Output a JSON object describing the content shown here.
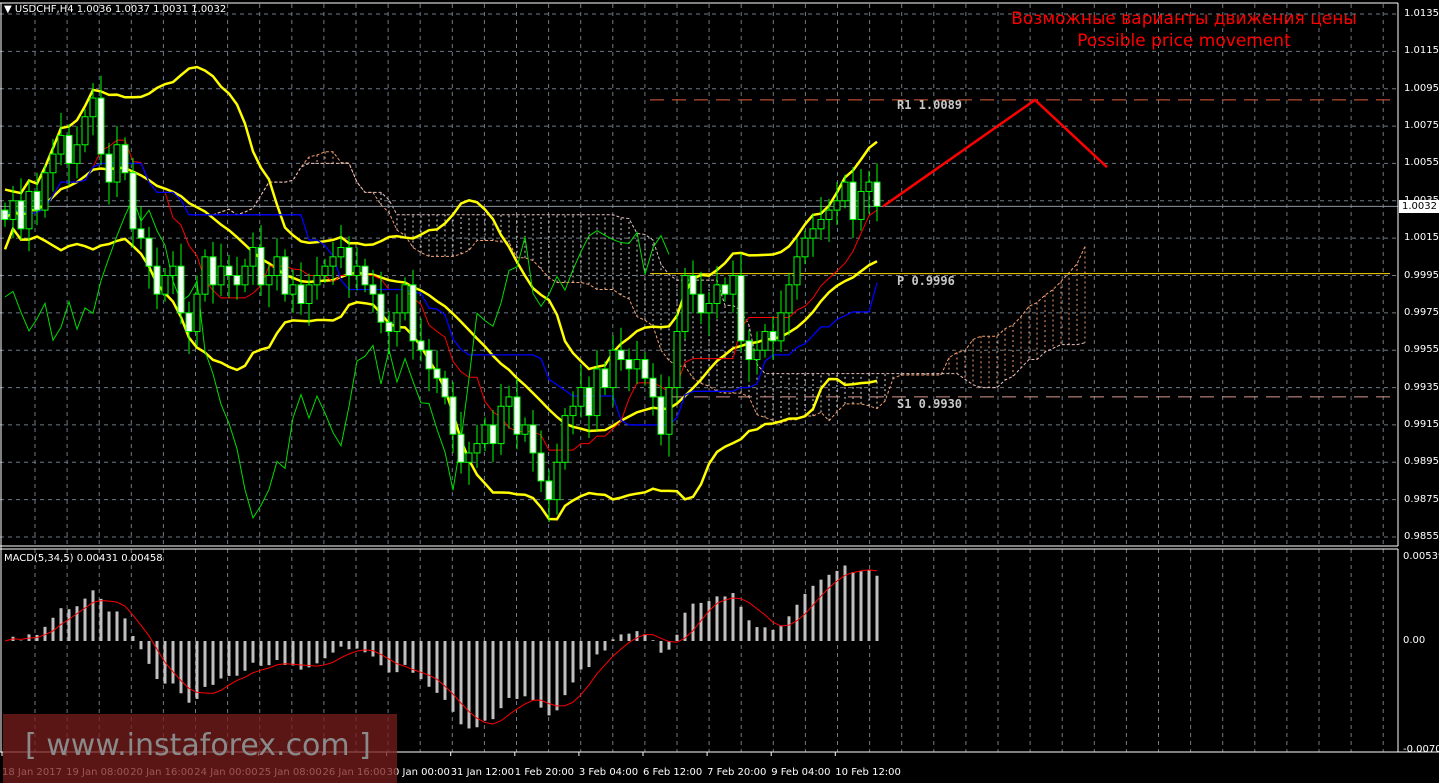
{
  "header": {
    "symbol_label": "USDCHF,H4",
    "ohlc": "1.0036 1.0037 1.0031 1.0032"
  },
  "annotation": {
    "line1": "Возможные варианты движения цены",
    "line2": "Possible price movement",
    "color": "#ff0000"
  },
  "levels": [
    {
      "label": "R1 1.0089",
      "price": 1.0089,
      "style": "dashed",
      "color": "#e0603a"
    },
    {
      "label": "P 0.9996",
      "price": 0.9996,
      "style": "solid",
      "color": "#ffd700"
    },
    {
      "label": "S1 0.9930",
      "price": 0.993,
      "style": "dashed",
      "color": "#d89a90"
    }
  ],
  "current_price": {
    "label": "1.0032",
    "price": 1.0032
  },
  "price_axis": [
    "1.0135",
    "1.0115",
    "1.0095",
    "1.0075",
    "1.0055",
    "1.0035",
    "1.0015",
    "0.9995",
    "0.9975",
    "0.9955",
    "0.9935",
    "0.9915",
    "0.9895",
    "0.9875",
    "0.9855"
  ],
  "macd": {
    "label": "MACD(5,34,5) 0.00431 0.00458",
    "axis": [
      "0.00539",
      "0.00",
      "-0.00709"
    ]
  },
  "time_axis": [
    "18 Jan 2017",
    "19 Jan 08:00",
    "20 Jan 16:00",
    "24 Jan 00:00",
    "25 Jan 08:00",
    "26 Jan 16:00",
    "30 Jan 00:00",
    "31 Jan 12:00",
    "1 Feb 20:00",
    "3 Feb 04:00",
    "6 Feb 12:00",
    "7 Feb 20:00",
    "9 Feb 04:00",
    "10 Feb 12:00"
  ],
  "watermark": "[ www.instaforex.com ]",
  "chart_data": {
    "type": "candlestick",
    "symbol": "USDCHF",
    "timeframe": "H4",
    "ylim": [
      0.9855,
      1.0135
    ],
    "grid": true,
    "closes": [
      1.0025,
      1.0035,
      1.002,
      1.004,
      1.003,
      1.005,
      1.006,
      1.007,
      1.0055,
      1.0065,
      1.008,
      1.009,
      1.006,
      1.0045,
      1.0065,
      1.005,
      1.002,
      1.0015,
      1.0,
      0.9985,
      0.9995,
      1.0,
      0.9975,
      0.9965,
      0.9985,
      1.0005,
      0.999,
      1.0,
      0.9995,
      0.999,
      1.0,
      1.001,
      0.999,
      0.9995,
      1.0005,
      0.9985,
      0.999,
      0.998,
      0.999,
      0.9995,
      1.0,
      1.0005,
      1.001,
      0.9995,
      1.0,
      0.999,
      0.9985,
      0.997,
      0.9965,
      0.9975,
      0.999,
      0.996,
      0.9955,
      0.9945,
      0.994,
      0.993,
      0.991,
      0.9895,
      0.99,
      0.9905,
      0.9915,
      0.9905,
      0.9925,
      0.993,
      0.991,
      0.9915,
      0.99,
      0.9885,
      0.9875,
      0.9895,
      0.992,
      0.9925,
      0.9935,
      0.992,
      0.9945,
      0.9935,
      0.9955,
      0.995,
      0.9945,
      0.995,
      0.994,
      0.993,
      0.991,
      0.9935,
      0.9965,
      0.9995,
      0.9985,
      0.9975,
      0.998,
      0.999,
      0.9985,
      0.9995,
      0.996,
      0.995,
      0.9955,
      0.9965,
      0.996,
      0.9975,
      0.999,
      1.0005,
      1.0015,
      1.002,
      1.0025,
      1.003,
      1.0035,
      1.0045,
      1.0025,
      1.004,
      1.0045,
      1.0032
    ],
    "indicators": [
      "Bollinger Bands",
      "Ichimoku",
      "MACD(5,34,5)"
    ],
    "colors": {
      "bollinger": "#ffff00",
      "tenkan": "#ff0000",
      "kijun": "#0000ff",
      "chikou": "#00dd00",
      "cloud": "#f4a070",
      "candle_outline": "#00ff00",
      "bear_body": "#ffffff",
      "macd_hist": "#c0c0c0",
      "macd_signal": "#ff0000"
    },
    "forecast_path": [
      {
        "bar": 110,
        "price": 1.0032
      },
      {
        "bar": 129,
        "price": 1.0089
      },
      {
        "bar": 138,
        "price": 1.0053
      }
    ]
  }
}
